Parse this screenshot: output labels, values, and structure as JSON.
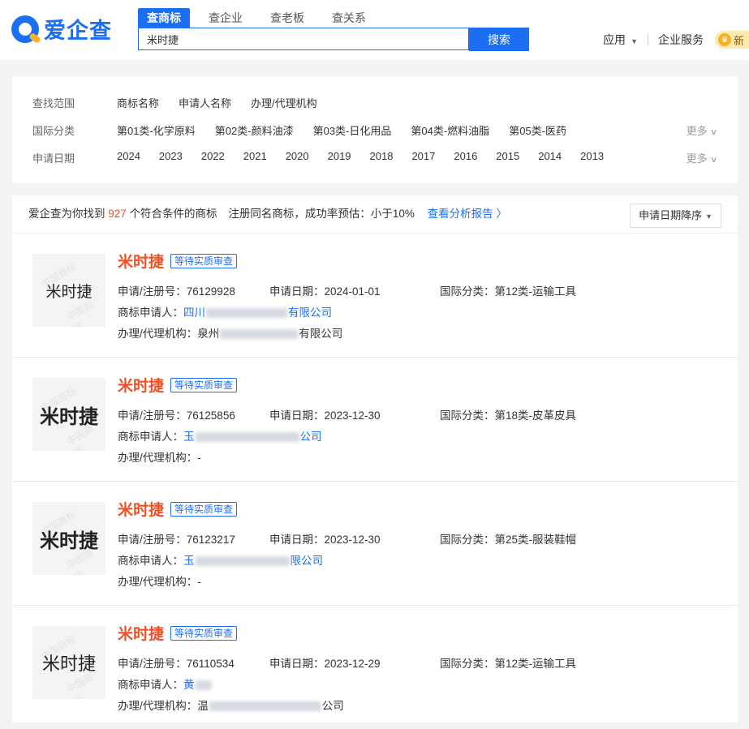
{
  "brand": {
    "name": "爱企查"
  },
  "header": {
    "tabs": [
      {
        "label": "查商标",
        "active": true
      },
      {
        "label": "查企业",
        "active": false
      },
      {
        "label": "查老板",
        "active": false
      },
      {
        "label": "查关系",
        "active": false
      }
    ],
    "search": {
      "value": "米时捷",
      "button": "搜索"
    },
    "right": {
      "app": "应用",
      "service": "企业服务",
      "vip": "新"
    }
  },
  "filters": {
    "scope": {
      "label": "查找范围",
      "options": [
        "商标名称",
        "申请人名称",
        "办理/代理机构"
      ]
    },
    "class": {
      "label": "国际分类",
      "options": [
        "第01类-化学原料",
        "第02类-颜料油漆",
        "第03类-日化用品",
        "第04类-燃料油脂",
        "第05类-医药"
      ],
      "more": "更多"
    },
    "date": {
      "label": "申请日期",
      "options": [
        "2024",
        "2023",
        "2022",
        "2021",
        "2020",
        "2019",
        "2018",
        "2017",
        "2016",
        "2015",
        "2014",
        "2013"
      ],
      "more": "更多"
    }
  },
  "results": {
    "prefix": "爱企查为你找到",
    "count": "927",
    "suffix": "个符合条件的商标",
    "tip": "注册同名商标，成功率预估：小于10%",
    "report_link": "查看分析报告",
    "sort": "申请日期降序",
    "items": [
      {
        "name": "米时捷",
        "status": "等待实质审查",
        "reg_label": "申请/注册号：",
        "reg_no": "76129928",
        "date_label": "申请日期：",
        "date": "2024-01-01",
        "class_label": "国际分类：",
        "class": "第12类-运输工具",
        "applicant_label": "商标申请人：",
        "applicant_head": "四川",
        "applicant_tail": "有限公司",
        "agency_label": "办理/代理机构：",
        "agency_head": "泉州",
        "agency_tail": "有限公司",
        "thumb_text": "米时捷"
      },
      {
        "name": "米时捷",
        "status": "等待实质审查",
        "reg_label": "申请/注册号：",
        "reg_no": "76125856",
        "date_label": "申请日期：",
        "date": "2023-12-30",
        "class_label": "国际分类：",
        "class": "第18类-皮革皮具",
        "applicant_label": "商标申请人：",
        "applicant_head": "玉",
        "applicant_tail": "公司",
        "agency_label": "办理/代理机构：",
        "agency": "-",
        "thumb_text": "米时捷"
      },
      {
        "name": "米时捷",
        "status": "等待实质审查",
        "reg_label": "申请/注册号：",
        "reg_no": "76123217",
        "date_label": "申请日期：",
        "date": "2023-12-30",
        "class_label": "国际分类：",
        "class": "第25类-服装鞋帽",
        "applicant_label": "商标申请人：",
        "applicant_head": "玉",
        "applicant_tail": "限公司",
        "agency_label": "办理/代理机构：",
        "agency": "-",
        "thumb_text": "米时捷"
      },
      {
        "name": "米时捷",
        "status": "等待实质审查",
        "reg_label": "申请/注册号：",
        "reg_no": "76110534",
        "date_label": "申请日期：",
        "date": "2023-12-29",
        "class_label": "国际分类：",
        "class": "第12类-运输工具",
        "applicant_label": "商标申请人：",
        "applicant_head": "黄",
        "agency_label": "办理/代理机构：",
        "agency_head": "温",
        "agency_tail": "公司",
        "thumb_text": "米时捷"
      }
    ]
  }
}
